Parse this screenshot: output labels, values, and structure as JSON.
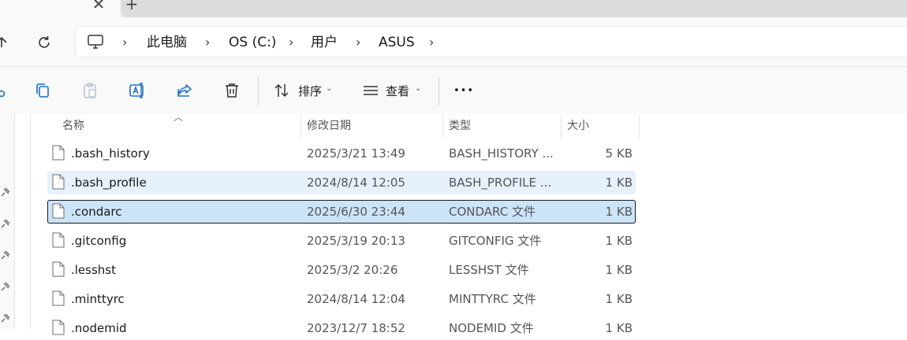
{
  "tabs": {
    "close_glyph": "✕",
    "new_glyph": "+"
  },
  "address": {
    "crumbs": [
      "此电脑",
      "OS (C:)",
      "用户",
      "ASUS"
    ],
    "separator": "›"
  },
  "toolbar": {
    "sort_label": "排序",
    "view_label": "查看",
    "more_label": "•••",
    "dropdown_glyph": "⌄"
  },
  "columns": {
    "name": "名称",
    "date": "修改日期",
    "type": "类型",
    "size": "大小"
  },
  "files": [
    {
      "name": ".bash_history",
      "date": "2025/3/21 13:49",
      "type": "BASH_HISTORY ...",
      "size": "5 KB",
      "state": "normal"
    },
    {
      "name": ".bash_profile",
      "date": "2024/8/14 12:05",
      "type": "BASH_PROFILE ...",
      "size": "1 KB",
      "state": "hover"
    },
    {
      "name": ".condarc",
      "date": "2025/6/30 23:44",
      "type": "CONDARC 文件",
      "size": "1 KB",
      "state": "selected"
    },
    {
      "name": ".gitconfig",
      "date": "2025/3/19 20:13",
      "type": "GITCONFIG 文件",
      "size": "1 KB",
      "state": "normal"
    },
    {
      "name": ".lesshst",
      "date": "2025/3/2 20:26",
      "type": "LESSHST 文件",
      "size": "1 KB",
      "state": "normal"
    },
    {
      "name": ".minttyrc",
      "date": "2024/8/14 12:04",
      "type": "MINTTYRC 文件",
      "size": "1 KB",
      "state": "normal"
    },
    {
      "name": ".nodemid",
      "date": "2023/12/7 18:52",
      "type": "NODEMID 文件",
      "size": "1 KB",
      "state": "normal"
    }
  ],
  "colors": {
    "accent": "#0067c0",
    "selected_bg": "#cce4f7",
    "hover_bg": "#e6f1fb"
  }
}
